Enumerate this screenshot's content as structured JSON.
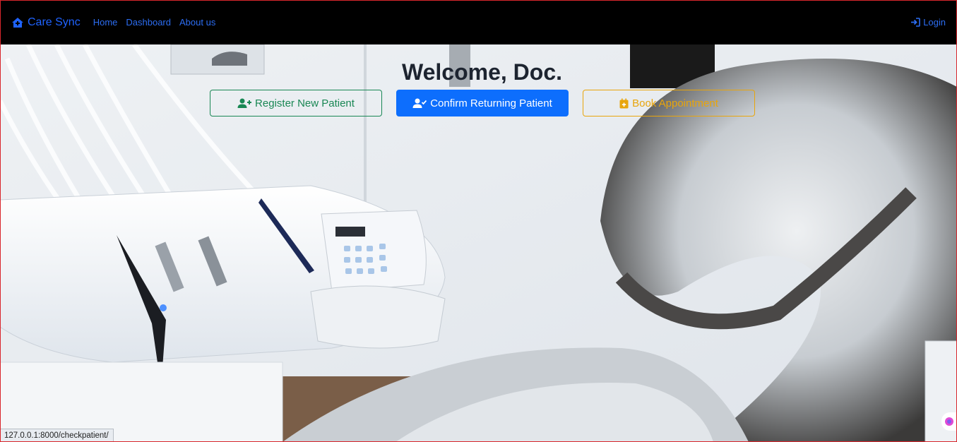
{
  "navbar": {
    "brand": "Care Sync",
    "links": [
      "Home",
      "Dashboard",
      "About us"
    ],
    "login": "Login"
  },
  "hero": {
    "title": "Welcome, Doc.",
    "buttons": {
      "register": "Register New Patient",
      "confirm": "Confirm Returning Patient",
      "book": "Book Appointment"
    }
  },
  "status_bar": {
    "url": "127.0.0.1:8000/checkpatient/"
  },
  "colors": {
    "navbar_bg": "#000000",
    "link": "#2c6df2",
    "success": "#198754",
    "primary": "#0d6efd",
    "warning": "#e8a50c"
  }
}
